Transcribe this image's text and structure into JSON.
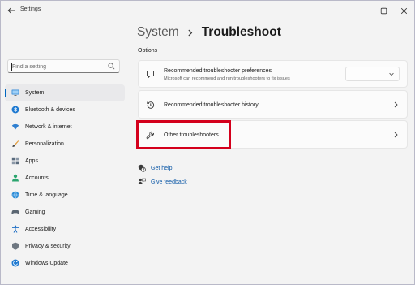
{
  "window": {
    "title": "Settings"
  },
  "sidebar": {
    "search": {
      "placeholder": "Find a setting"
    },
    "items": [
      {
        "label": "System",
        "icon": "system-icon",
        "active": true
      },
      {
        "label": "Bluetooth & devices",
        "icon": "bluetooth-icon"
      },
      {
        "label": "Network & internet",
        "icon": "network-icon"
      },
      {
        "label": "Personalization",
        "icon": "personalization-icon"
      },
      {
        "label": "Apps",
        "icon": "apps-icon"
      },
      {
        "label": "Accounts",
        "icon": "accounts-icon"
      },
      {
        "label": "Time & language",
        "icon": "time-language-icon"
      },
      {
        "label": "Gaming",
        "icon": "gaming-icon"
      },
      {
        "label": "Accessibility",
        "icon": "accessibility-icon"
      },
      {
        "label": "Privacy & security",
        "icon": "privacy-icon"
      },
      {
        "label": "Windows Update",
        "icon": "windows-update-icon"
      }
    ]
  },
  "main": {
    "breadcrumb": {
      "parent": "System",
      "current": "Troubleshoot"
    },
    "section_label": "Options",
    "cards": [
      {
        "title": "Recommended troubleshooter preferences",
        "subtitle": "Microsoft can recommend and run troubleshooters to fix issues",
        "icon": "chat-bubble-icon"
      },
      {
        "title": "Recommended troubleshooter history",
        "icon": "history-icon"
      },
      {
        "title": "Other troubleshooters",
        "icon": "wrench-icon"
      }
    ],
    "links": [
      {
        "label": "Get help",
        "icon": "help-icon"
      },
      {
        "label": "Give feedback",
        "icon": "feedback-icon"
      }
    ]
  },
  "colors": {
    "accent": "#0067c0",
    "highlight": "#d4001c",
    "link": "#0b57a6"
  }
}
